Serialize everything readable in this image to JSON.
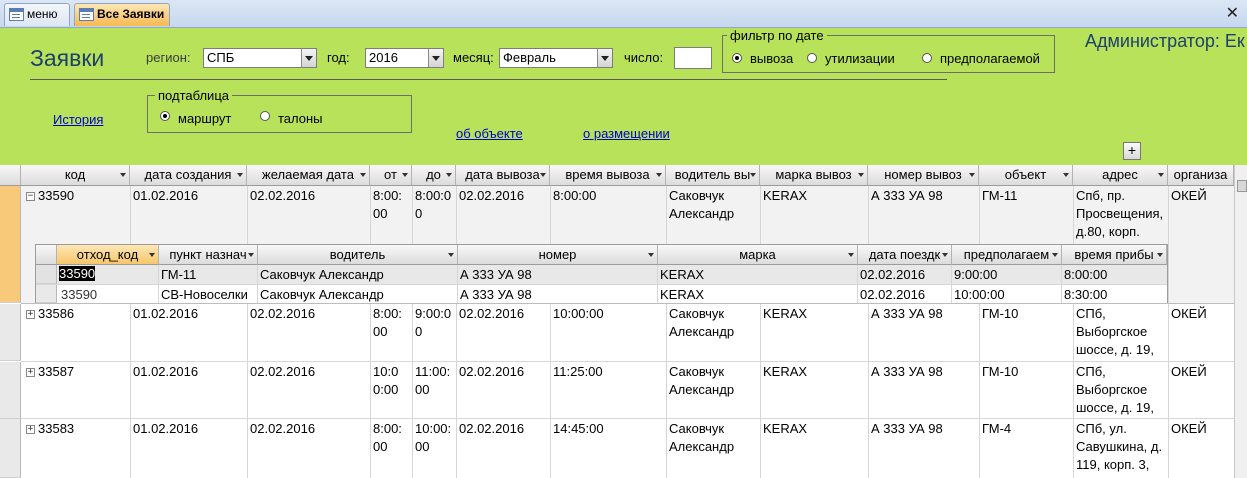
{
  "tabs": [
    {
      "label": "меню",
      "active": false
    },
    {
      "label": "Все Заявки",
      "active": true
    }
  ],
  "header": {
    "title": "Заявки",
    "admin_label": "Администратор: Ек",
    "region_label": "регион:",
    "region_value": "СПБ",
    "year_label": "год:",
    "year_value": "2016",
    "month_label": "месяц:",
    "month_value": "Февраль",
    "day_label": "число:",
    "day_value": "",
    "date_filter": {
      "title": "фильтр по дате",
      "options": [
        "вывоза",
        "утилизации",
        "предполагаемой"
      ],
      "selected": 0
    },
    "subtable": {
      "title": "подтаблица",
      "options": [
        "маршрут",
        "талоны"
      ],
      "selected": 0
    },
    "history_link": "История",
    "object_link": "об объекте",
    "placement_link": "о размещении",
    "plus_button": "+"
  },
  "grid": {
    "columns": [
      "код",
      "дата создания",
      "желаемая дата",
      "от",
      "до",
      "дата вывоза",
      "время вывоза",
      "водитель вы",
      "марка вывоз",
      "номер вывоз",
      "объект",
      "адрес",
      "организа"
    ],
    "rows": [
      {
        "expanded": true,
        "cells": [
          "33590",
          "01.02.2016",
          "02.02.2016",
          "8:00:00",
          "8:00:00",
          "02.02.2016",
          "8:00:00",
          "Саковчук Александр",
          "KERAX",
          "А 333 УА 98",
          "ГМ-11",
          "Спб, пр. Просвещения, д.80, корп.",
          "ОКЕЙ"
        ]
      },
      {
        "expanded": false,
        "cells": [
          "33586",
          "01.02.2016",
          "02.02.2016",
          "8:00:00",
          "9:00:00",
          "02.02.2016",
          "10:00:00",
          "Саковчук Александр",
          "KERAX",
          "А 333 УА 98",
          "ГМ-10",
          "СПб, Выборгское шоссе, д. 19,",
          "ОКЕЙ"
        ]
      },
      {
        "expanded": false,
        "cells": [
          "33587",
          "01.02.2016",
          "02.02.2016",
          "10:00:00",
          "11:00:00",
          "02.02.2016",
          "11:25:00",
          "Саковчук Александр",
          "KERAX",
          "А 333 УА 98",
          "ГМ-10",
          "СПб, Выборгское шоссе, д. 19,",
          "ОКЕЙ"
        ]
      },
      {
        "expanded": false,
        "cells": [
          "33583",
          "01.02.2016",
          "02.02.2016",
          "8:00:00",
          "10:00:00",
          "02.02.2016",
          "14:45:00",
          "Саковчук Александр",
          "KERAX",
          "А 333 УА 98",
          "ГМ-4",
          "СПб, ул. Савушкина, д. 119, корп. 3,",
          "ОКЕЙ"
        ]
      }
    ],
    "subgrid": {
      "columns": [
        "отход_код",
        "пункт назнач",
        "водитель",
        "номер",
        "марка",
        "дата поездк",
        "предполагаем",
        "время прибы"
      ],
      "rows": [
        [
          "33590",
          "ГМ-11",
          "Саковчук Александр",
          "А 333 УА 98",
          "KERAX",
          "02.02.2016",
          "9:00:00",
          "8:00:00"
        ],
        [
          "33590",
          "СВ-Новоселки",
          "Саковчук Александр",
          "А 333 УА 98",
          "KERAX",
          "02.02.2016",
          "10:00:00",
          "8:30:00"
        ]
      ]
    }
  },
  "colors": {
    "header_bg": "#b7e25a",
    "active_tab": "#f7b951",
    "current_row": "#f9c97a"
  },
  "icons": [
    "form-tab-icon",
    "close-icon",
    "dropdown-arrow-icon",
    "expand-icon",
    "collapse-icon"
  ]
}
